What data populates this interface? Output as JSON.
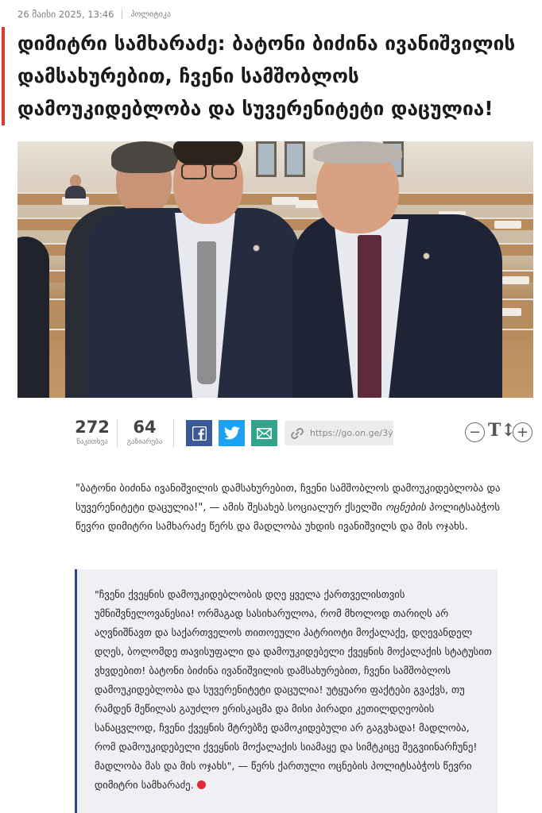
{
  "article": {
    "date": "26 მაისი 2025, 13:46",
    "category": "პოლიტიკა",
    "title": "დიმიტრი სამხარაძე: ბატონი ბიძინა ივანიშვილის დამსახურებით, ჩვენი სამშობლოს დამოუკიდებლობა და სუვერენიტეტი დაცულია!"
  },
  "stats": {
    "views": "272",
    "views_label": "წაკითხვა",
    "shares": "64",
    "shares_label": "გაზიარება"
  },
  "share": {
    "url": "https://go.on.ge/3ẏ"
  },
  "font_controls": {
    "decrease": "−",
    "size_glyph": "T↕",
    "increase": "+"
  },
  "body": {
    "lead_before": "\"ბატონი ბიძინა ივანიშვილის დამსახურებით, ჩვენი სამშობლოს დამოუკიდებლობა და სუვერენიტეტი დაცულია!\", — ამის შესახებ სოციალურ ქსელში ",
    "lead_emph": "ოცნების",
    "lead_after": " პოლიტსაბჭოს წევრი დიმიტრი სამხარაძე წერს და მადლობა უხდის ივანიშვილს და მის ოჯახს.",
    "quote": "\"ჩვენი ქვეყნის დამოუკიდებლობის დღე ყველა ქართველისთვის უმნიშვნელოვანესია! ორმაგად სასიხარულოა, რომ მხოლოდ თარიღს არ აღვნიშნავთ და საქართველოს თითოეული პატრიოტი მოქალაქე, დღევანდელ დღეს, ბოლომდე თავისუფალი და დამოუკიდებელი ქვეყნის მოქალაქის სტატუსით ვხვდებით! ბატონი ბიძინა ივანიშვილის დამსახურებით, ჩვენი სამშობლოს დამოუკიდებლობა და სუვერენიტეტი დაცულია! უტყუარი ფაქტები გვაქვს, თუ რამდენ მეწილას გაუძლო ერისკაცმა და მისი პირადი კეთილდღეობის სანაცვლოდ, ჩვენი ქვეყნის მტრებზე დამოკიდებული არ გაგვხადა! მადლობა, რომ დამოუკიდებელი ქვეყნის მოქალაქის სიამაყე და სიმტკიცე შეგვიინარჩუნე! მადლობა მას და მის ოჯახს\", — წერს ქართული ოცნების პოლიტსაბჭოს წევრი დიმიტრი სამხარაძე."
  },
  "colors": {
    "accent": "#e23a2e",
    "facebook": "#3b5998",
    "twitter": "#1da1f2",
    "email": "#32a48d",
    "quote_border": "#2b4c7e",
    "quote_bg": "#eef0f3"
  },
  "icons": [
    "facebook-icon",
    "twitter-icon",
    "email-icon",
    "link-icon",
    "minus-icon",
    "text-size-icon",
    "plus-icon"
  ]
}
